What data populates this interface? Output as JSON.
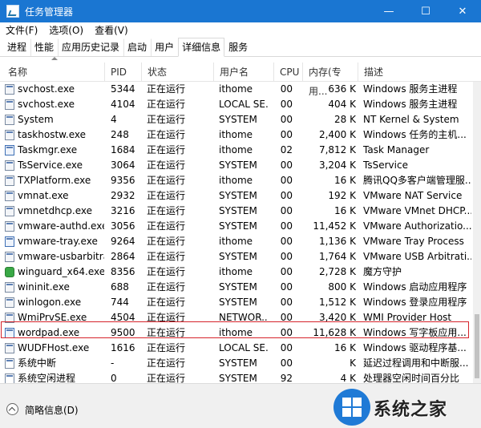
{
  "window": {
    "title": "任务管理器",
    "minimize": "—",
    "maximize": "☐",
    "close": "✕"
  },
  "menu": [
    "文件(F)",
    "选项(O)",
    "查看(V)"
  ],
  "tabs": [
    "进程",
    "性能",
    "应用历史记录",
    "启动",
    "用户",
    "详细信息",
    "服务"
  ],
  "active_tab": "详细信息",
  "columns": [
    "名称",
    "PID",
    "状态",
    "用户名",
    "CPU",
    "内存(专用...",
    "描述"
  ],
  "rows": [
    {
      "name": "svchost.exe",
      "pid": "5344",
      "status": "正在运行",
      "user": "ithome",
      "cpu": "00",
      "mem": "636 K",
      "desc": "Windows 服务主进程",
      "icon": "process-window-icon"
    },
    {
      "name": "svchost.exe",
      "pid": "4104",
      "status": "正在运行",
      "user": "LOCAL SE...",
      "cpu": "00",
      "mem": "404 K",
      "desc": "Windows 服务主进程",
      "icon": "process-window-icon"
    },
    {
      "name": "System",
      "pid": "4",
      "status": "正在运行",
      "user": "SYSTEM",
      "cpu": "00",
      "mem": "28 K",
      "desc": "NT Kernel & System",
      "icon": "process-window-icon"
    },
    {
      "name": "taskhostw.exe",
      "pid": "248",
      "status": "正在运行",
      "user": "ithome",
      "cpu": "00",
      "mem": "2,400 K",
      "desc": "Windows 任务的主机...",
      "icon": "process-window-icon"
    },
    {
      "name": "Taskmgr.exe",
      "pid": "1684",
      "status": "正在运行",
      "user": "ithome",
      "cpu": "02",
      "mem": "7,812 K",
      "desc": "Task Manager",
      "icon": "task-manager-icon"
    },
    {
      "name": "TsService.exe",
      "pid": "3064",
      "status": "正在运行",
      "user": "SYSTEM",
      "cpu": "00",
      "mem": "3,204 K",
      "desc": "TsService",
      "icon": "process-window-icon"
    },
    {
      "name": "TXPlatform.exe",
      "pid": "9356",
      "status": "正在运行",
      "user": "ithome",
      "cpu": "00",
      "mem": "16 K",
      "desc": "腾讯QQ多客户端管理服...",
      "icon": "process-window-icon"
    },
    {
      "name": "vmnat.exe",
      "pid": "2932",
      "status": "正在运行",
      "user": "SYSTEM",
      "cpu": "00",
      "mem": "192 K",
      "desc": "VMware NAT Service",
      "icon": "process-window-icon"
    },
    {
      "name": "vmnetdhcp.exe",
      "pid": "3216",
      "status": "正在运行",
      "user": "SYSTEM",
      "cpu": "00",
      "mem": "16 K",
      "desc": "VMware VMnet DHCP...",
      "icon": "process-window-icon"
    },
    {
      "name": "vmware-authd.exe",
      "pid": "3056",
      "status": "正在运行",
      "user": "SYSTEM",
      "cpu": "00",
      "mem": "11,452 K",
      "desc": "VMware Authorizatio...",
      "icon": "process-window-icon"
    },
    {
      "name": "vmware-tray.exe",
      "pid": "9264",
      "status": "正在运行",
      "user": "ithome",
      "cpu": "00",
      "mem": "1,136 K",
      "desc": "VMware Tray Process",
      "icon": "vmware-tray-icon"
    },
    {
      "name": "vmware-usbarbitra...",
      "pid": "2864",
      "status": "正在运行",
      "user": "SYSTEM",
      "cpu": "00",
      "mem": "1,764 K",
      "desc": "VMware USB Arbitrati...",
      "icon": "process-window-icon"
    },
    {
      "name": "winguard_x64.exe",
      "pid": "8356",
      "status": "正在运行",
      "user": "ithome",
      "cpu": "00",
      "mem": "2,728 K",
      "desc": "魔方守护",
      "icon": "winguard-icon"
    },
    {
      "name": "wininit.exe",
      "pid": "688",
      "status": "正在运行",
      "user": "SYSTEM",
      "cpu": "00",
      "mem": "800 K",
      "desc": "Windows 启动应用程序",
      "icon": "process-window-icon"
    },
    {
      "name": "winlogon.exe",
      "pid": "744",
      "status": "正在运行",
      "user": "SYSTEM",
      "cpu": "00",
      "mem": "1,512 K",
      "desc": "Windows 登录应用程序",
      "icon": "process-window-icon"
    },
    {
      "name": "WmiPrvSE.exe",
      "pid": "4504",
      "status": "正在运行",
      "user": "NETWOR...",
      "cpu": "00",
      "mem": "3,420 K",
      "desc": "WMI Provider Host",
      "icon": "process-window-icon"
    },
    {
      "name": "wordpad.exe",
      "pid": "9500",
      "status": "正在运行",
      "user": "ithome",
      "cpu": "00",
      "mem": "11,628 K",
      "desc": "Windows 写字板应用...",
      "icon": "wordpad-icon"
    },
    {
      "name": "WUDFHost.exe",
      "pid": "1616",
      "status": "正在运行",
      "user": "LOCAL SE...",
      "cpu": "00",
      "mem": "16 K",
      "desc": "Windows 驱动程序基...",
      "icon": "process-window-icon"
    },
    {
      "name": "系统中断",
      "pid": "-",
      "status": "正在运行",
      "user": "SYSTEM",
      "cpu": "00",
      "mem": "K",
      "desc": "延迟过程调用和中断服...",
      "icon": "system-interrupt-icon"
    },
    {
      "name": "系统空闲进程",
      "pid": "0",
      "status": "正在运行",
      "user": "SYSTEM",
      "cpu": "92",
      "mem": "4 K",
      "desc": "处理器空闲时间百分比",
      "icon": "system-idle-icon"
    }
  ],
  "highlighted_row": "wordpad.exe",
  "footer": {
    "fewer_details": "简略信息(D)"
  },
  "watermark": {
    "text": "系统之家"
  }
}
